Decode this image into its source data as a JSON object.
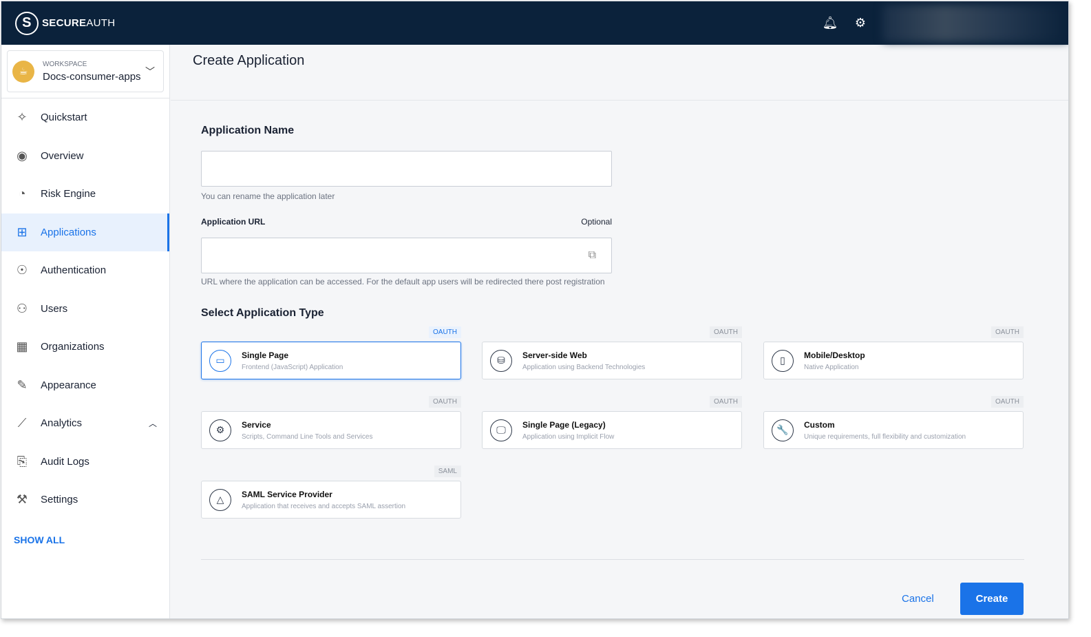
{
  "brand": {
    "bold": "SECURE",
    "light": "AUTH"
  },
  "workspace": {
    "label": "WORKSPACE",
    "name": "Docs-consumer-apps"
  },
  "nav": [
    {
      "label": "Quickstart",
      "icon": "✧"
    },
    {
      "label": "Overview",
      "icon": "◉"
    },
    {
      "label": "Risk Engine",
      "icon": "◔"
    },
    {
      "label": "Applications",
      "icon": "⊞"
    },
    {
      "label": "Authentication",
      "icon": "☉"
    },
    {
      "label": "Users",
      "icon": "⚇"
    },
    {
      "label": "Organizations",
      "icon": "▦"
    },
    {
      "label": "Appearance",
      "icon": "✎"
    },
    {
      "label": "Analytics",
      "icon": "⟋"
    },
    {
      "label": "Audit Logs",
      "icon": "⎘"
    },
    {
      "label": "Settings",
      "icon": "⚒"
    }
  ],
  "show_all": "SHOW ALL",
  "page_title": "Create Application",
  "form": {
    "name_label": "Application Name",
    "name_value": "",
    "name_help": "You can rename the application later",
    "url_label": "Application URL",
    "url_optional": "Optional",
    "url_value": "",
    "url_help": "URL where the application can be accessed. For the default app users will be redirected there post registration",
    "type_label": "Select Application Type"
  },
  "types": [
    {
      "title": "Single Page",
      "sub": "Frontend (JavaScript) Application",
      "tag": "OAUTH",
      "icon": "▭",
      "selected": true
    },
    {
      "title": "Server-side Web",
      "sub": "Application using Backend Technologies",
      "tag": "OAUTH",
      "icon": "⛁"
    },
    {
      "title": "Mobile/Desktop",
      "sub": "Native Application",
      "tag": "OAUTH",
      "icon": "▯"
    },
    {
      "title": "Service",
      "sub": "Scripts, Command Line Tools and Services",
      "tag": "OAUTH",
      "icon": "⚙"
    },
    {
      "title": "Single Page (Legacy)",
      "sub": "Application using Implicit Flow",
      "tag": "OAUTH",
      "icon": "🖵"
    },
    {
      "title": "Custom",
      "sub": "Unique requirements, full flexibility and customization",
      "tag": "OAUTH",
      "icon": "🔧"
    },
    {
      "title": "SAML Service Provider",
      "sub": "Application that receives and accepts SAML assertion",
      "tag": "SAML",
      "icon": "△"
    }
  ],
  "actions": {
    "cancel": "Cancel",
    "create": "Create"
  }
}
